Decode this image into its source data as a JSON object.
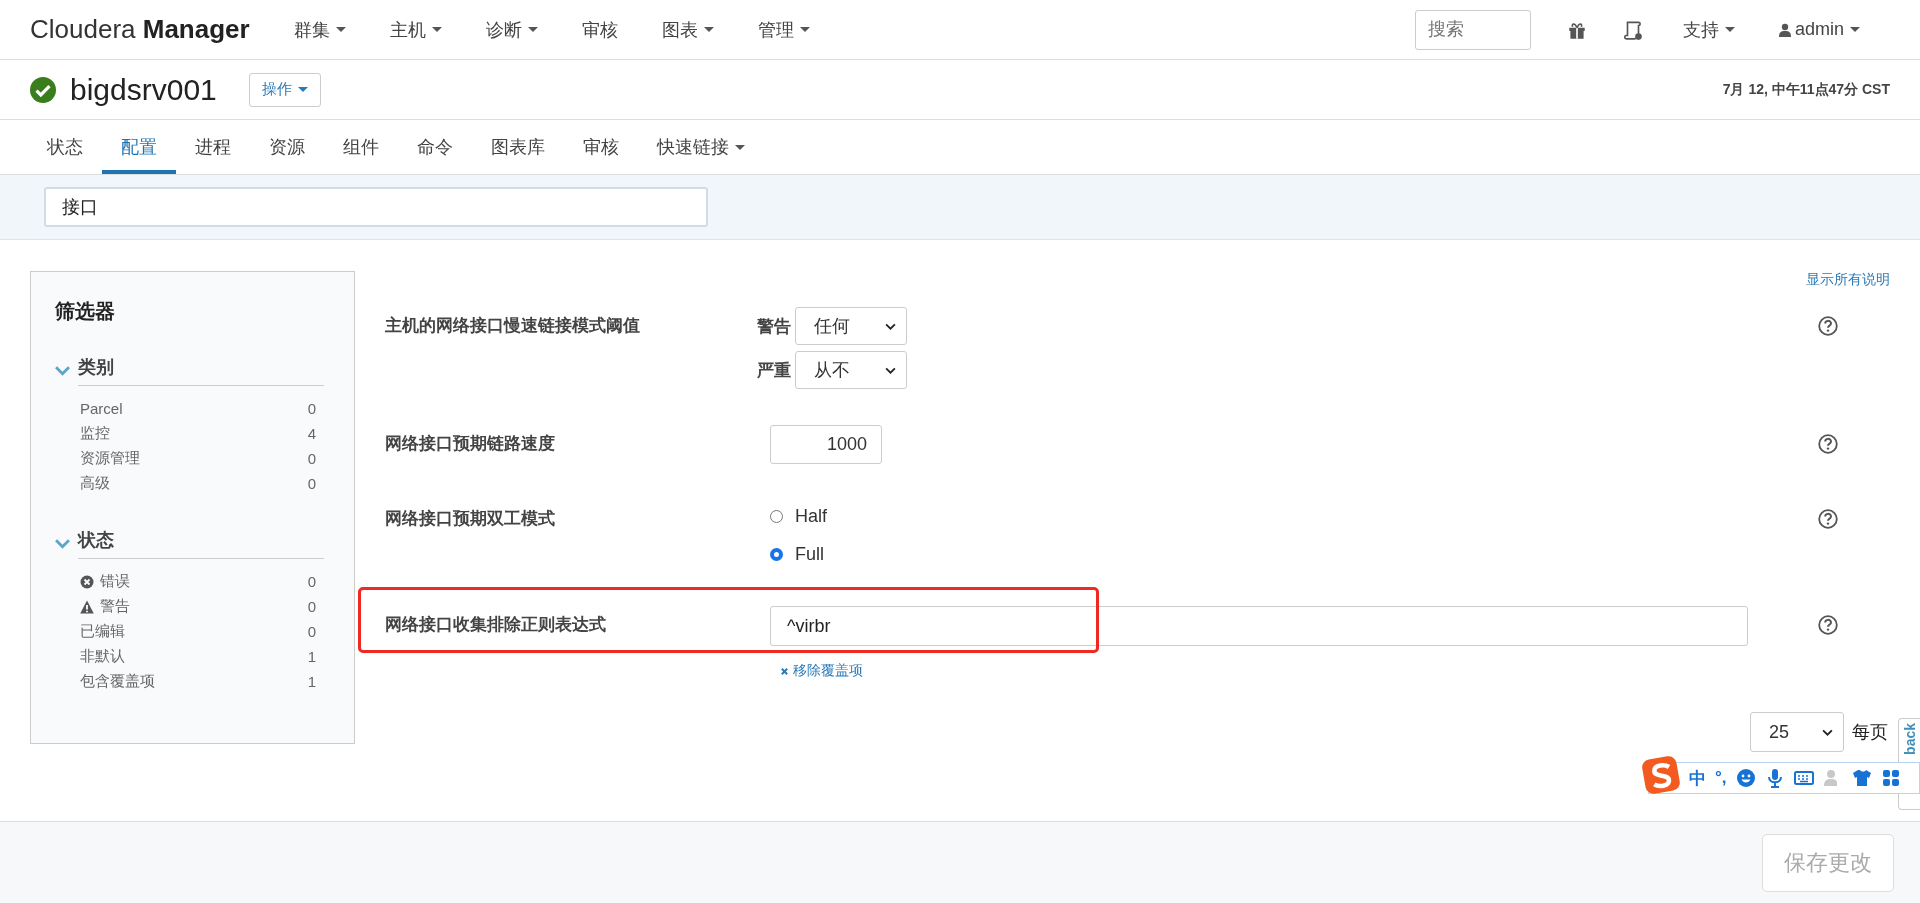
{
  "topnav": {
    "brand_light": "Cloudera",
    "brand_bold": "Manager",
    "menus": [
      {
        "label": "群集",
        "dropdown": true
      },
      {
        "label": "主机",
        "dropdown": true
      },
      {
        "label": "诊断",
        "dropdown": true
      },
      {
        "label": "审核",
        "dropdown": false
      },
      {
        "label": "图表",
        "dropdown": true
      },
      {
        "label": "管理",
        "dropdown": true
      }
    ],
    "search": {
      "placeholder": "搜索"
    },
    "support": "支持",
    "user": "admin"
  },
  "host": {
    "name": "bigdsrv001",
    "actions": "操作",
    "timestamp": "7月 12, 中午11点47分 CST"
  },
  "tabs": [
    {
      "label": "状态",
      "selected": false,
      "dropdown": false
    },
    {
      "label": "配置",
      "selected": true,
      "dropdown": false
    },
    {
      "label": "进程",
      "selected": false,
      "dropdown": false
    },
    {
      "label": "资源",
      "selected": false,
      "dropdown": false
    },
    {
      "label": "组件",
      "selected": false,
      "dropdown": false
    },
    {
      "label": "命令",
      "selected": false,
      "dropdown": false
    },
    {
      "label": "图表库",
      "selected": false,
      "dropdown": false
    },
    {
      "label": "审核",
      "selected": false,
      "dropdown": false
    },
    {
      "label": "快速链接",
      "selected": false,
      "dropdown": true
    }
  ],
  "filter_search": {
    "value": "接口"
  },
  "filters": {
    "title": "筛选器",
    "groups": [
      {
        "title": "类别",
        "expanded": true,
        "items": [
          {
            "label": "Parcel",
            "count": "0"
          },
          {
            "label": "监控",
            "count": "4"
          },
          {
            "label": "资源管理",
            "count": "0"
          },
          {
            "label": "高级",
            "count": "0"
          }
        ]
      },
      {
        "title": "状态",
        "expanded": true,
        "items": [
          {
            "label": "错误",
            "count": "0",
            "kind": "error"
          },
          {
            "label": "警告",
            "count": "0",
            "kind": "warning"
          },
          {
            "label": "已编辑",
            "count": "0"
          },
          {
            "label": "非默认",
            "count": "1"
          },
          {
            "label": "包含覆盖项",
            "count": "1"
          }
        ]
      }
    ]
  },
  "show_all_descriptions": "显示所有说明",
  "settings": [
    {
      "kind": "thresholds",
      "label": "主机的网络接口慢速链接模式阈值",
      "highlighted": false,
      "thresholds": [
        {
          "label": "警告",
          "value": "任何"
        },
        {
          "label": "严重",
          "value": "从不"
        }
      ]
    },
    {
      "kind": "number",
      "label": "网络接口预期链路速度",
      "highlighted": false,
      "value": "1000"
    },
    {
      "kind": "radio",
      "label": "网络接口预期双工模式",
      "highlighted": false,
      "options": [
        {
          "label": "Half",
          "selected": false
        },
        {
          "label": "Full",
          "selected": true
        }
      ]
    },
    {
      "kind": "text",
      "label": "网络接口收集排除正则表达式",
      "highlighted": true,
      "value": "^virbr",
      "remove_override": "移除覆盖项"
    }
  ],
  "pagination": {
    "per_page_value": "25",
    "per_page_label": "每页"
  },
  "feedback_tab": "back",
  "ime_toolbar": {
    "mode": "中",
    "punct": "°,"
  },
  "footer": {
    "save": "保存更改",
    "save_disabled": true
  }
}
